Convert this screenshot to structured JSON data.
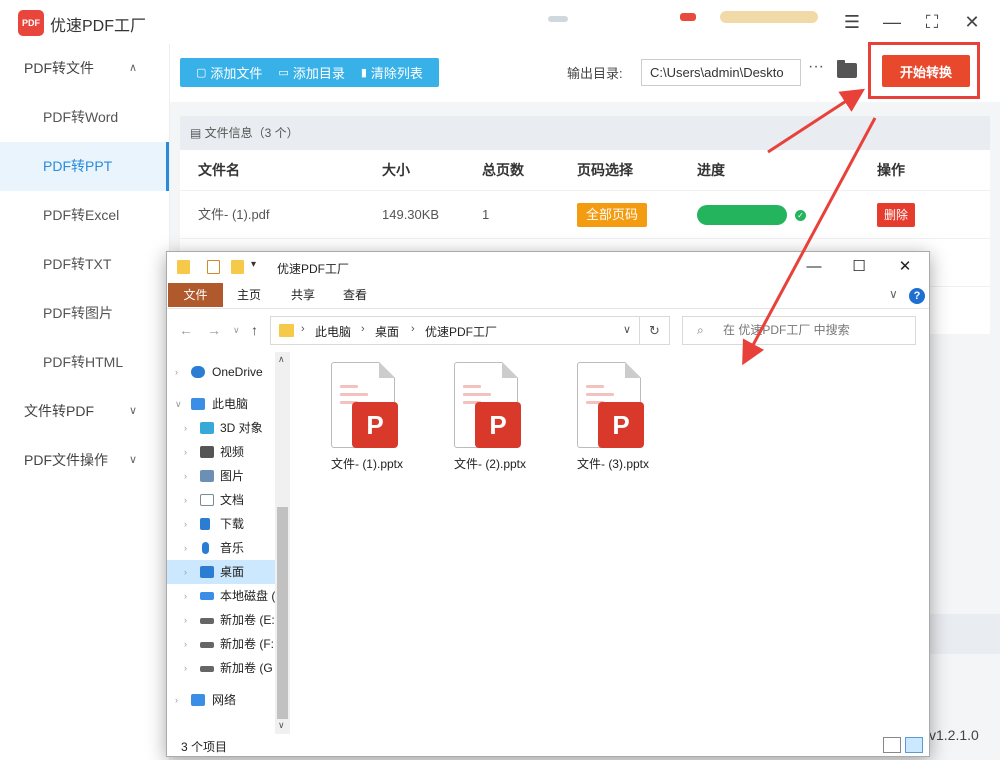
{
  "app": {
    "title": "优速PDF工厂",
    "logo_text": "PDF",
    "version": "v1.2.1.0",
    "accent": "#2a8bdc",
    "brand_red": "#e8482c"
  },
  "window_controls": {
    "menu_icon": "☰",
    "minimize_icon": "—",
    "maximize_icon": "⛶",
    "close_icon": "✕"
  },
  "sidebar": {
    "groups": [
      {
        "label": "PDF转文件",
        "chevron": "∧",
        "expanded": true,
        "items": [
          {
            "label": "PDF转Word"
          },
          {
            "label": "PDF转PPT",
            "active": true
          },
          {
            "label": "PDF转Excel"
          },
          {
            "label": "PDF转TXT"
          },
          {
            "label": "PDF转图片"
          },
          {
            "label": "PDF转HTML"
          }
        ]
      },
      {
        "label": "文件转PDF",
        "chevron": "∨"
      },
      {
        "label": "PDF文件操作",
        "chevron": "∨"
      }
    ]
  },
  "toolbar": {
    "add_file": "添加文件",
    "add_folder": "添加目录",
    "clear_list": "清除列表",
    "output_label": "输出目录:",
    "output_path": "C:\\Users\\admin\\Deskto",
    "more_icon": "···",
    "start_button": "开始转换"
  },
  "file_list": {
    "info_label": "文件信息（3 个）",
    "columns": [
      "文件名",
      "大小",
      "总页数",
      "页码选择",
      "进度",
      "操作"
    ],
    "rows": [
      {
        "name": "文件- (1).pdf",
        "size": "149.30KB",
        "pages": "1",
        "page_select": "全部页码",
        "progress": 1.0,
        "action": "删除"
      }
    ]
  },
  "explorer": {
    "title": "优速PDF工厂",
    "ribbon_tabs": [
      "文件",
      "主页",
      "共享",
      "查看"
    ],
    "help_icon": "?",
    "breadcrumbs": [
      "此电脑",
      "桌面",
      "优速PDF工厂"
    ],
    "search_placeholder": "在 优速PDF工厂 中搜索",
    "nav_tree": [
      {
        "label": "OneDrive",
        "icon": "cloud-icon",
        "color": "#2b7cd3"
      },
      {
        "label": "此电脑",
        "icon": "computer-icon",
        "color": "#3a8ee6"
      },
      {
        "label": "3D 对象",
        "icon": "cube-icon",
        "color": "#37a8d8"
      },
      {
        "label": "视频",
        "icon": "film-icon",
        "color": "#555555"
      },
      {
        "label": "图片",
        "icon": "picture-icon",
        "color": "#6b8fb5"
      },
      {
        "label": "文档",
        "icon": "document-icon",
        "color": "#7a8a9a"
      },
      {
        "label": "下载",
        "icon": "download-icon",
        "color": "#2b7cd3"
      },
      {
        "label": "音乐",
        "icon": "music-icon",
        "color": "#2b7cd3"
      },
      {
        "label": "桌面",
        "icon": "desktop-icon",
        "color": "#2b7cd3",
        "selected": true
      },
      {
        "label": "本地磁盘 (",
        "icon": "windows-disk-icon",
        "color": "#3a8ee6"
      },
      {
        "label": "新加卷 (E:",
        "icon": "disk-icon",
        "color": "#666666"
      },
      {
        "label": "新加卷 (F:",
        "icon": "disk-icon",
        "color": "#666666"
      },
      {
        "label": "新加卷 (G",
        "icon": "disk-icon",
        "color": "#666666"
      },
      {
        "label": "网络",
        "icon": "network-icon",
        "color": "#3a8ee6"
      }
    ],
    "files": [
      {
        "name": "文件- (1).pptx",
        "badge": "P"
      },
      {
        "name": "文件- (2).pptx",
        "badge": "P"
      },
      {
        "name": "文件- (3).pptx",
        "badge": "P"
      }
    ],
    "status": "3 个项目"
  }
}
